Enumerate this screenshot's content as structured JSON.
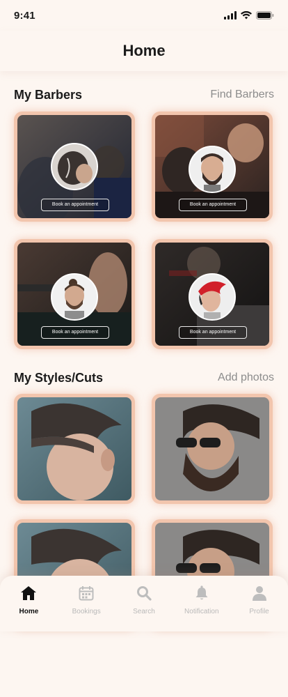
{
  "status": {
    "time": "9:41"
  },
  "header": {
    "title": "Home"
  },
  "barbers": {
    "title": "My Barbers",
    "link": "Find Barbers",
    "button_label": "Book an appointment",
    "cards": [
      {
        "name": "barber-card-1",
        "bg": "#3b3a3e"
      },
      {
        "name": "barber-card-2",
        "bg": "#4a332c"
      },
      {
        "name": "barber-card-3",
        "bg": "#2f2a29"
      },
      {
        "name": "barber-card-4",
        "bg": "#27211f"
      }
    ]
  },
  "styles": {
    "title": "My Styles/Cuts",
    "link": "Add photos"
  },
  "tabs": [
    {
      "label": "Home",
      "icon": "home-icon",
      "active": true
    },
    {
      "label": "Bookings",
      "icon": "calendar-icon",
      "active": false
    },
    {
      "label": "Search",
      "icon": "search-icon",
      "active": false
    },
    {
      "label": "Notification",
      "icon": "bell-icon",
      "active": false
    },
    {
      "label": "Profile",
      "icon": "person-icon",
      "active": false
    }
  ],
  "colors": {
    "accent": "#f2c5ad",
    "background": "#fdf6f1",
    "muted_text": "#8c8c8c"
  }
}
